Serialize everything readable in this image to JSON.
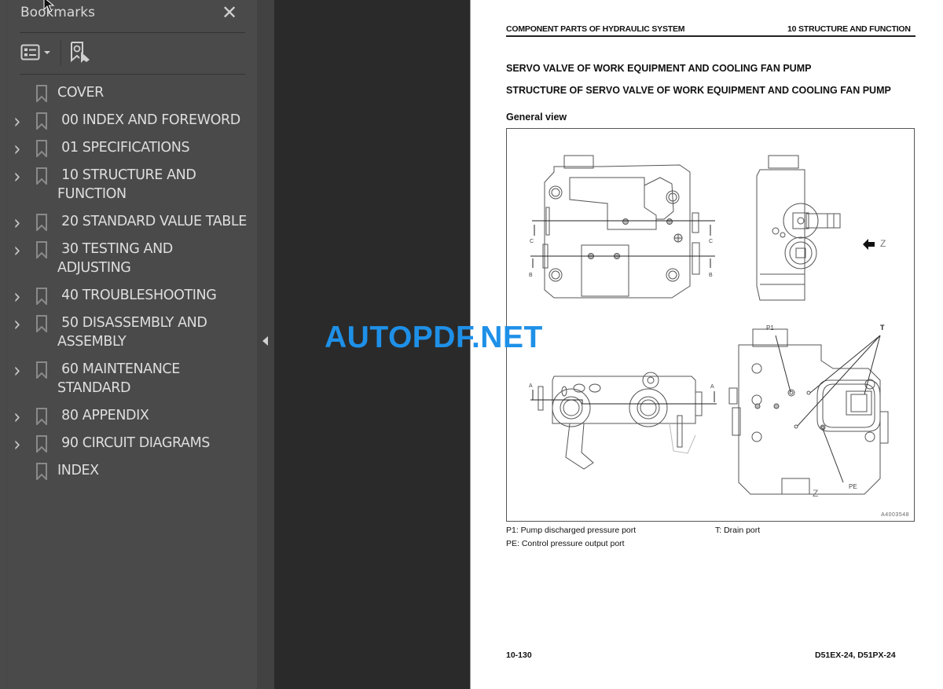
{
  "sidebar": {
    "title": "Bookmarks",
    "close_label": "✕",
    "toolbar": {
      "options_icon": "bookmark-options-icon",
      "find_icon": "find-current-bookmark-icon"
    },
    "items": [
      {
        "label": "COVER",
        "expandable": false
      },
      {
        "label": " 00 INDEX AND FOREWORD",
        "expandable": true
      },
      {
        "label": " 01 SPECIFICATIONS",
        "expandable": true
      },
      {
        "label": " 10 STRUCTURE AND FUNCTION",
        "expandable": true
      },
      {
        "label": " 20 STANDARD VALUE TABLE",
        "expandable": true
      },
      {
        "label": " 30 TESTING AND ADJUSTING",
        "expandable": true
      },
      {
        "label": " 40 TROUBLESHOOTING",
        "expandable": true
      },
      {
        "label": " 50 DISASSEMBLY AND ASSEMBLY",
        "expandable": true
      },
      {
        "label": " 60 MAINTENANCE STANDARD",
        "expandable": true
      },
      {
        "label": " 80 APPENDIX",
        "expandable": true
      },
      {
        "label": " 90 CIRCUIT DIAGRAMS",
        "expandable": true
      },
      {
        "label": "INDEX",
        "expandable": false
      }
    ]
  },
  "page": {
    "header_left": "COMPONENT PARTS OF HYDRAULIC SYSTEM",
    "header_right": "10 STRUCTURE AND FUNCTION",
    "heading1": "SERVO VALVE OF WORK EQUIPMENT AND COOLING FAN PUMP",
    "heading2": "STRUCTURE OF SERVO VALVE OF WORK EQUIPMENT AND COOLING FAN PUMP",
    "heading3": "General view",
    "figure": {
      "id": "A4003548",
      "section_labels": [
        "C",
        "C",
        "B",
        "B",
        "A",
        "A"
      ],
      "view_label": "Z",
      "callouts": [
        "P1",
        "T",
        "PE"
      ]
    },
    "legend": [
      "P1: Pump discharged pressure port",
      "T: Drain port",
      "PE: Control pressure output port"
    ],
    "footer_left": "10-130",
    "footer_right": "D51EX-24, D51PX-24"
  },
  "watermark": "AUTOPDF.NET",
  "colors": {
    "sidebar_bg": "#4a4a4a",
    "canvas_bg": "#2a2a2a",
    "watermark": "#1e90e8"
  }
}
